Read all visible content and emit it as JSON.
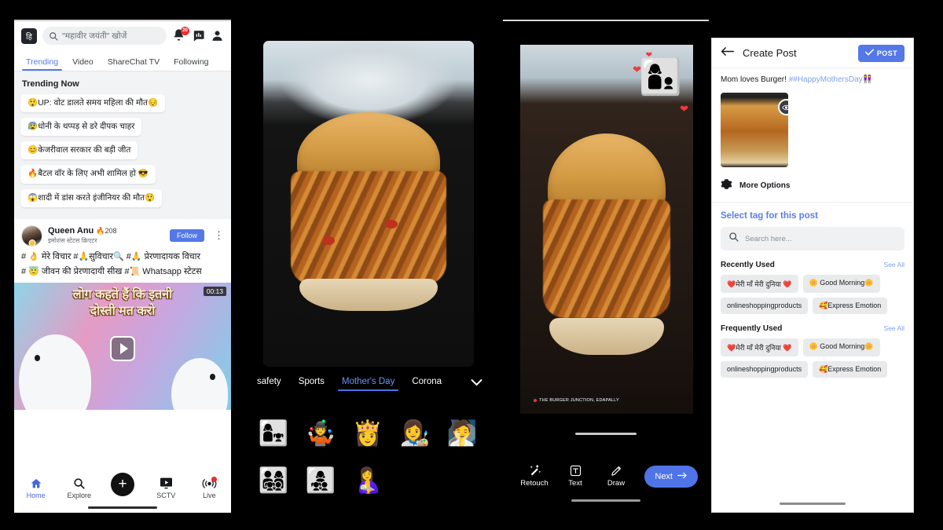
{
  "feed_panel": {
    "topbar": {
      "language_label": "हि",
      "search_placeholder": "\"महावीर जयंती\" खोजें",
      "notification_badge": "20",
      "icons": [
        "bell-icon",
        "chat-poll-icon",
        "profile-icon"
      ]
    },
    "tabs": [
      {
        "label": "Trending",
        "active": true
      },
      {
        "label": "Video",
        "active": false
      },
      {
        "label": "ShareChat TV",
        "active": false
      },
      {
        "label": "Following",
        "active": false
      }
    ],
    "trending_title": "Trending Now",
    "trending_items": [
      "😲UP: वोट डालते समय महिला की मौत😔",
      "😰धोनी के थप्पड़ से डरे दीपक चाहर",
      "😊केजरीवाल सरकार की बड़ी जीत",
      "🔥बैटल वॉर के लिए अभी शामिल हो 😎",
      "😱शादी में डांस करते इंजीनियर की मौत😲"
    ],
    "post": {
      "author": "Queen Anu",
      "fire_count": "208",
      "subtitle": "इमोशंस स्टेटस क्रिएटर",
      "follow_label": "Follow",
      "hashtags_line1": "# 👌 मेरे विचार #🙏सुविचार🔍 #🙏 प्रेरणादायक विचार",
      "hashtags_line2": "# 😇 जीवन की प्रेरणादायी सीख #📜 Whatsapp स्टेटस",
      "duration": "00:13",
      "media_text_line1": "लोग कहते हैं कि इतनी",
      "media_text_line2": "दोस्ती मत करो"
    },
    "bottom_nav": [
      {
        "label": "Home",
        "icon": "home-icon",
        "active": true
      },
      {
        "label": "Explore",
        "icon": "search-icon",
        "active": false
      },
      {
        "label": "",
        "icon": "plus-icon",
        "active": false
      },
      {
        "label": "SCTV",
        "icon": "tv-icon",
        "active": false
      },
      {
        "label": "Live",
        "icon": "live-broadcast-icon",
        "active": false
      }
    ]
  },
  "sticker_panel": {
    "categories": [
      {
        "label": "safety",
        "active": false
      },
      {
        "label": "Sports",
        "active": false
      },
      {
        "label": "Mother's Day",
        "active": true
      },
      {
        "label": "Corona",
        "active": false
      }
    ],
    "expand_icon": "chevron-down-icon",
    "stickers": [
      "👩‍👧",
      "🤹",
      "👸",
      "👩‍🎨",
      "🧖",
      "👨‍👩‍👧‍👦",
      "👩‍👧‍👦",
      "🤱"
    ]
  },
  "editor_panel": {
    "watermark": "THE BURGER JUNCTION, EDAPALLY",
    "side_tools": [
      "filter-icon",
      "sticker-icon",
      "crop-icon",
      "add-image-icon"
    ],
    "actions": [
      {
        "label": "Retouch",
        "icon": "magic-wand-icon"
      },
      {
        "label": "Text",
        "icon": "text-box-icon"
      },
      {
        "label": "Draw",
        "icon": "pencil-icon"
      }
    ],
    "next_label": "Next",
    "next_icon": "arrow-right-icon",
    "applied_sticker": "👩‍👦"
  },
  "create_post_panel": {
    "back_icon": "arrow-left-icon",
    "title": "Create Post",
    "post_label": "POST",
    "post_check_icon": "check-icon",
    "caption_text": "Mom loves Burger! ",
    "caption_tag": "##HappyMothersDay",
    "caption_emoji": "👭",
    "preview_overlay_icon": "eye-icon",
    "more_options_label": "More Options",
    "more_options_icon": "gear-icon",
    "select_tag_label": "Select tag for this post",
    "search_placeholder": "Search here...",
    "search_icon": "search-icon",
    "recently_used_label": "Recently Used",
    "frequently_used_label": "Frequently Used",
    "see_all_label": "See All",
    "recently_used_tags": [
      "❤️मेरी माँ मेरी दुनिया ❤️",
      "🌼 Good Morning🌼",
      "onlineshoppingproducts",
      "🥰Express Emotion"
    ],
    "frequently_used_tags": [
      "❤️मेरी माँ मेरी दुनिया ❤️",
      "🌼 Good Morning🌼",
      "onlineshoppingproducts",
      "🥰Express Emotion"
    ]
  },
  "colors": {
    "accent_blue": "#5478e8",
    "badge_red": "#ef2b2b",
    "chip_grey": "#e9eaec"
  }
}
